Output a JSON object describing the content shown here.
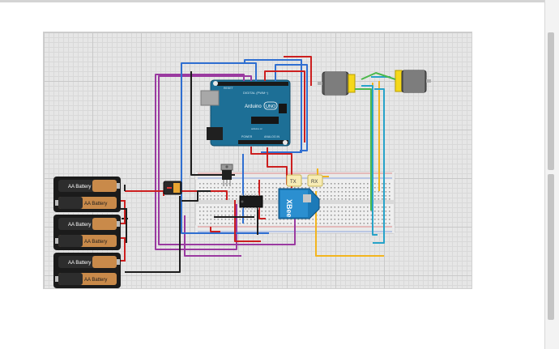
{
  "arduino": {
    "name": "Arduino",
    "model": "UNO",
    "reset_label": "RESET",
    "digital_label": "DIGITAL (PWM~)",
    "power_label": "POWER",
    "analog_label": "ANALOG IN",
    "url": "arduino.cc"
  },
  "batteries": [
    {
      "label_top": "AA Battery",
      "label_bottom": "AA Battery"
    },
    {
      "label_top": "AA Battery",
      "label_bottom": "AA Battery"
    },
    {
      "label_top": "AA Battery",
      "label_bottom": "AA Battery"
    }
  ],
  "xbee": {
    "label": "XBee"
  },
  "led_tx": {
    "label": "TX"
  },
  "led_rx": {
    "label": "RX"
  },
  "colors": {
    "wire_red": "#cc1f1f",
    "wire_blue": "#2f6fd1",
    "wire_purple": "#9a3aa0",
    "wire_black": "#1e1e1e",
    "wire_yellow": "#f2b51f",
    "wire_cyan": "#27a3c9",
    "wire_green": "#4cb84c",
    "arduino_blue": "#1d6f96",
    "breadboard": "#ededed",
    "motor_yellow": "#f5d81a"
  }
}
